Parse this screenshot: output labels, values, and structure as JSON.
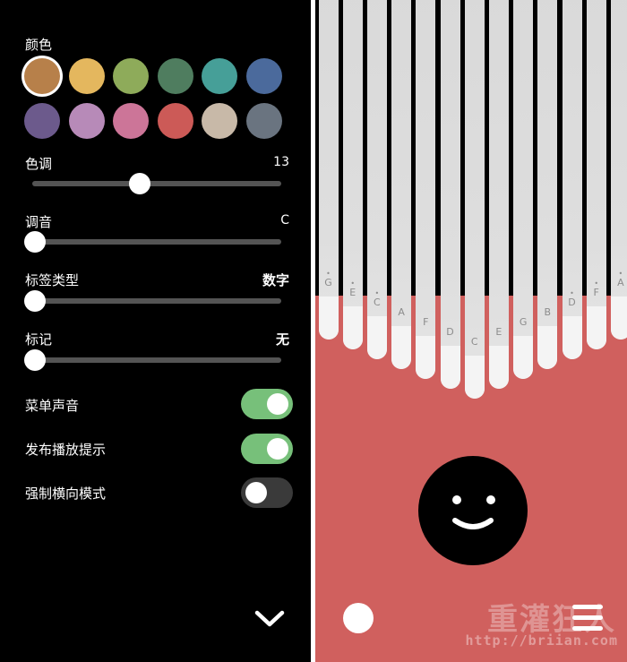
{
  "settings": {
    "color": {
      "label": "颜色",
      "swatches": [
        "#b7804a",
        "#e4b75e",
        "#8eab5a",
        "#4f7d5f",
        "#469f98",
        "#4b6a9c",
        "#6c5a8c",
        "#b78ab8",
        "#cc7598",
        "#cc5a57",
        "#c8b9a8",
        "#6a7480"
      ],
      "selected_index": 0
    },
    "hue": {
      "label": "色调",
      "value": "13",
      "level": 0.43
    },
    "tuning": {
      "label": "调音",
      "value": "C",
      "level": 0
    },
    "label_type": {
      "label": "标签类型",
      "value": "数字",
      "level": 0
    },
    "marking": {
      "label": "标记",
      "value": "无",
      "level": 0
    },
    "toggles": [
      {
        "label": "菜单声音",
        "on": true
      },
      {
        "label": "发布播放提示",
        "on": true
      },
      {
        "label": "强制横向模式",
        "on": false
      }
    ],
    "collapse_icon": "chevron-down-icon"
  },
  "kalimba": {
    "colors": {
      "body": "#d0605e",
      "tine": "#dcdcdc",
      "tip": "#f4f4f4"
    },
    "tines": [
      {
        "note": "G",
        "mark": "dot-above"
      },
      {
        "note": "E",
        "mark": "dot-above"
      },
      {
        "note": "C",
        "mark": "dot-above"
      },
      {
        "note": "A",
        "mark": ""
      },
      {
        "note": "F",
        "mark": ""
      },
      {
        "note": "D",
        "mark": ""
      },
      {
        "note": "C",
        "mark": ""
      },
      {
        "note": "E",
        "mark": ""
      },
      {
        "note": "G",
        "mark": ""
      },
      {
        "note": "B",
        "mark": ""
      },
      {
        "note": "D",
        "mark": "dot-above"
      },
      {
        "note": "F",
        "mark": "dot-above"
      },
      {
        "note": "A",
        "mark": "dot-above"
      }
    ],
    "face_icon": "smiley-face-icon",
    "record_icon": "record-dot-icon",
    "menu_icon": "hamburger-menu-icon"
  },
  "watermark": {
    "title": "重灌狂人",
    "url": "http://briian.com"
  }
}
